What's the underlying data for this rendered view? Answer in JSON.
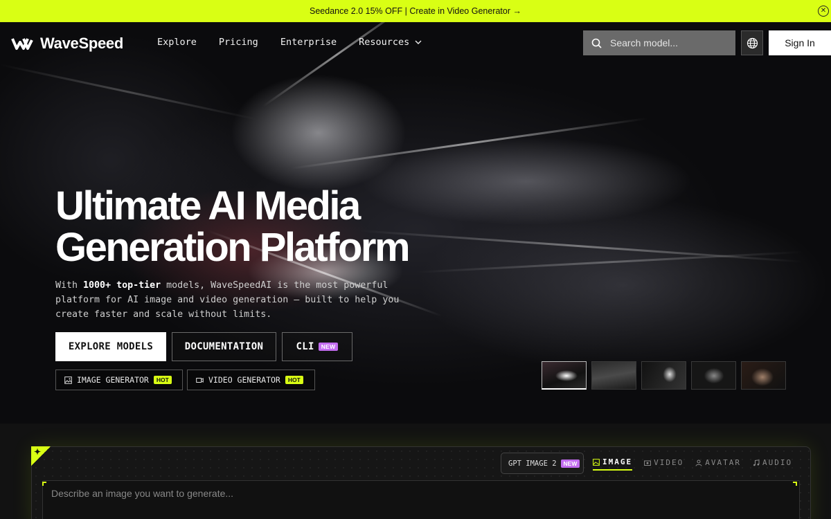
{
  "promo": {
    "text": "Seedance 2.0 15% OFF | Create in Video Generator →",
    "close_icon": "close-circle-icon"
  },
  "nav": {
    "logo_text": "WaveSpeed",
    "links": [
      "Explore",
      "Pricing",
      "Enterprise",
      "Resources"
    ],
    "search_placeholder": "Search model...",
    "sign_in": "Sign In"
  },
  "hero": {
    "title_line1": "Ultimate AI Media",
    "title_line2": "Generation Platform",
    "subtitle_prefix": "With ",
    "subtitle_bold": "1000+ top-tier",
    "subtitle_rest": " models, WaveSpeedAI is the most powerful platform for AI image and video generation — built to help you create faster and scale without limits.",
    "buttons": {
      "explore": "EXPLORE MODELS",
      "docs": "DOCUMENTATION",
      "cli": "CLI",
      "cli_badge": "NEW"
    },
    "chips": {
      "image": "IMAGE GENERATOR",
      "video": "VIDEO GENERATOR",
      "badge": "HOT"
    }
  },
  "generator": {
    "model_label": "GPT IMAGE 2",
    "model_badge": "NEW",
    "tabs": [
      "IMAGE",
      "VIDEO",
      "AVATAR",
      "AUDIO"
    ],
    "active_tab": "IMAGE",
    "prompt_placeholder": "Describe an image you want to generate..."
  },
  "colors": {
    "accent": "#d9ff14",
    "new_badge": "#c26cf0",
    "background": "#0a0a0a"
  }
}
